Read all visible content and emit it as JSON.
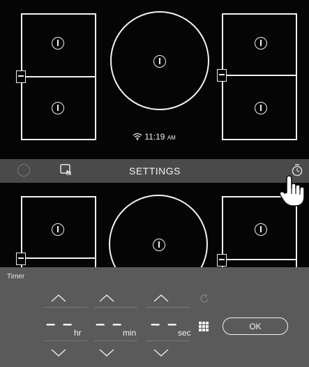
{
  "cooktop": {
    "clock": {
      "time": "11:19",
      "ampm": "AM"
    },
    "settings_label": "SETTINGS"
  },
  "timer": {
    "title": "Timer",
    "hours": "– –",
    "minutes": "– –",
    "seconds": "– –",
    "hours_unit": "hr",
    "minutes_unit": "min",
    "seconds_unit": "sec",
    "ok_label": "OK"
  },
  "icons": {
    "zone_power": "power-icon",
    "bridge": "bridge-icon",
    "wifi": "wifi-icon",
    "lock": "lock-icon",
    "timer": "timer-icon",
    "reset": "reset-icon",
    "keypad": "keypad-icon",
    "hand": "hand-pointer-icon",
    "chevron_up": "chevron-up-icon",
    "chevron_down": "chevron-down-icon"
  },
  "colors": {
    "panel": "#050505",
    "settings_bar": "#4a4a4a",
    "timer_panel": "#5a5a5a",
    "line": "#f2f2f2"
  }
}
